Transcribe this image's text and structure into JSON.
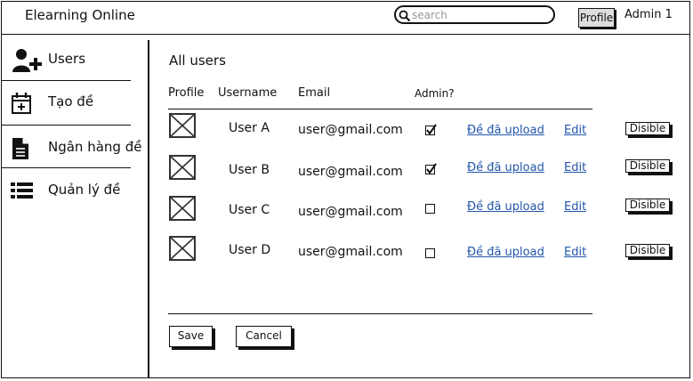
{
  "header": {
    "app_title": "Elearning Online",
    "search_placeholder": "search",
    "profile_label": "Profile",
    "user_name": "Admin 1"
  },
  "sidebar": {
    "items": [
      {
        "label": "Users",
        "icon": "add-user-icon"
      },
      {
        "label": "Tạo đề",
        "icon": "calendar-add-icon"
      },
      {
        "label": "Ngân hàng đề",
        "icon": "document-icon"
      },
      {
        "label": "Quản lý đề",
        "icon": "list-icon"
      }
    ]
  },
  "main": {
    "title": "All users",
    "columns": [
      "Profile",
      "Username",
      "Email",
      "Admin?"
    ],
    "rows": [
      {
        "username": "User A",
        "email": "user@gmail.com",
        "admin": true,
        "uploads_link": "Đề đã upload",
        "edit_link": "Edit",
        "disable_label": "Disible"
      },
      {
        "username": "User B",
        "email": "user@gmail.com",
        "admin": true,
        "uploads_link": "Đề đã upload",
        "edit_link": "Edit",
        "disable_label": "Disible"
      },
      {
        "username": "User C",
        "email": "user@gmail.com",
        "admin": false,
        "uploads_link": "Đề đã upload",
        "edit_link": "Edit",
        "disable_label": "Disible"
      },
      {
        "username": "User D",
        "email": "user@gmail.com",
        "admin": false,
        "uploads_link": "Đề đã upload",
        "edit_link": "Edit",
        "disable_label": "Disible"
      }
    ],
    "save_label": "Save",
    "cancel_label": "Cancel"
  },
  "colors": {
    "link": "#2255aa",
    "profile_button_bg": "#dddddd"
  }
}
